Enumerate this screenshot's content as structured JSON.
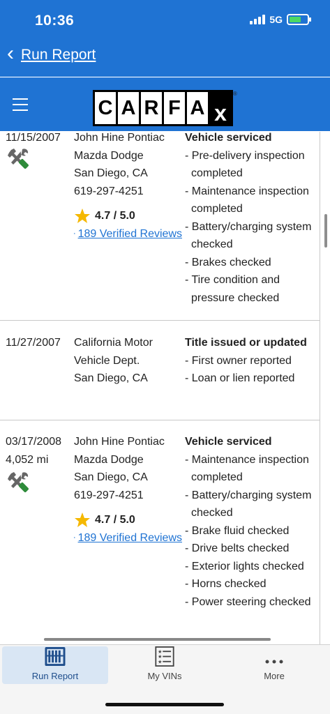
{
  "status_bar": {
    "time": "10:36",
    "network": "5G"
  },
  "nav": {
    "back_label": "Run Report"
  },
  "logo": {
    "letters": [
      "C",
      "A",
      "R",
      "F",
      "A",
      "x"
    ]
  },
  "records": [
    {
      "date": "11/15/2007",
      "mileage": "",
      "source_lines": [
        "John Hine Pontiac",
        "Mazda Dodge",
        "San Diego, CA",
        "619-297-4251"
      ],
      "rating": "4.7 / 5.0",
      "reviews": "189 Verified Reviews",
      "comment_title": "Vehicle serviced",
      "comments": [
        "Pre-delivery inspection completed",
        "Maintenance inspection completed",
        "Battery/charging system checked",
        "Brakes checked",
        "Tire condition and pressure checked"
      ]
    },
    {
      "date": "11/27/2007",
      "source_lines": [
        "California Motor Vehicle Dept.",
        "San Diego, CA"
      ],
      "comment_title": "Title issued or updated",
      "comments": [
        "First owner reported",
        "Loan or lien reported"
      ]
    },
    {
      "date": "03/17/2008",
      "mileage": "4,052 mi",
      "source_lines": [
        "John Hine Pontiac",
        "Mazda Dodge",
        "San Diego, CA",
        "619-297-4251"
      ],
      "rating": "4.7 / 5.0",
      "reviews": "189 Verified Reviews",
      "comment_title": "Vehicle serviced",
      "comments": [
        "Maintenance inspection completed",
        "Battery/charging system checked",
        "Brake fluid checked",
        "Drive belts checked",
        "Exterior lights checked",
        "Horns checked",
        "Power steering checked"
      ]
    }
  ],
  "tabs": [
    {
      "label": "Run Report",
      "icon": "run-report-icon",
      "active": true
    },
    {
      "label": "My VINs",
      "icon": "list-icon",
      "active": false
    },
    {
      "label": "More",
      "icon": "more-icon",
      "active": false
    }
  ],
  "colors": {
    "header_blue": "#1f73d3",
    "link_blue": "#1f73d3",
    "star_gold": "#f5b800",
    "tool_green": "#2e8b3a",
    "active_tab_bg": "#d9e6f4"
  }
}
